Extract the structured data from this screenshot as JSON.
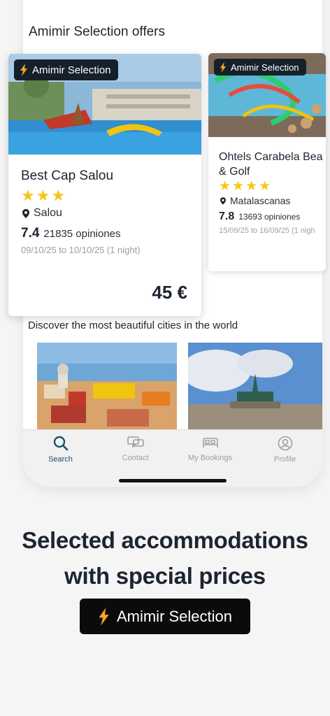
{
  "section_title": "Amimir Selection offers",
  "badge_label": "Amimir Selection",
  "cards": [
    {
      "name": "Best Cap Salou",
      "stars": 3,
      "location": "Salou",
      "score": "7.4",
      "reviews": "21835 opiniones",
      "dates": "09/10/25 to 10/10/25 (1 night)",
      "price": "45 €"
    },
    {
      "name_line1": "Ohtels Carabela Bea",
      "name_line2": "& Golf",
      "stars": 4,
      "location": "Matalascanas",
      "score": "7.8",
      "reviews": "13693 opiniones",
      "dates": "15/09/25 to 16/09/25 (1 nigh"
    }
  ],
  "discover_text": "Discover the most beautiful cities in the world",
  "tabs": [
    {
      "label": "Search",
      "icon": "search-icon"
    },
    {
      "label": "Contact",
      "icon": "chat-icon"
    },
    {
      "label": "My Bookings",
      "icon": "bed-icon"
    },
    {
      "label": "Profile",
      "icon": "profile-icon"
    }
  ],
  "headline_line1": "Selected accommodations",
  "headline_line2": "with special prices",
  "colors": {
    "accent": "#1a4f72",
    "star": "#f5c518",
    "bolt": "#f5a623",
    "badge_bg": "#15202b"
  }
}
